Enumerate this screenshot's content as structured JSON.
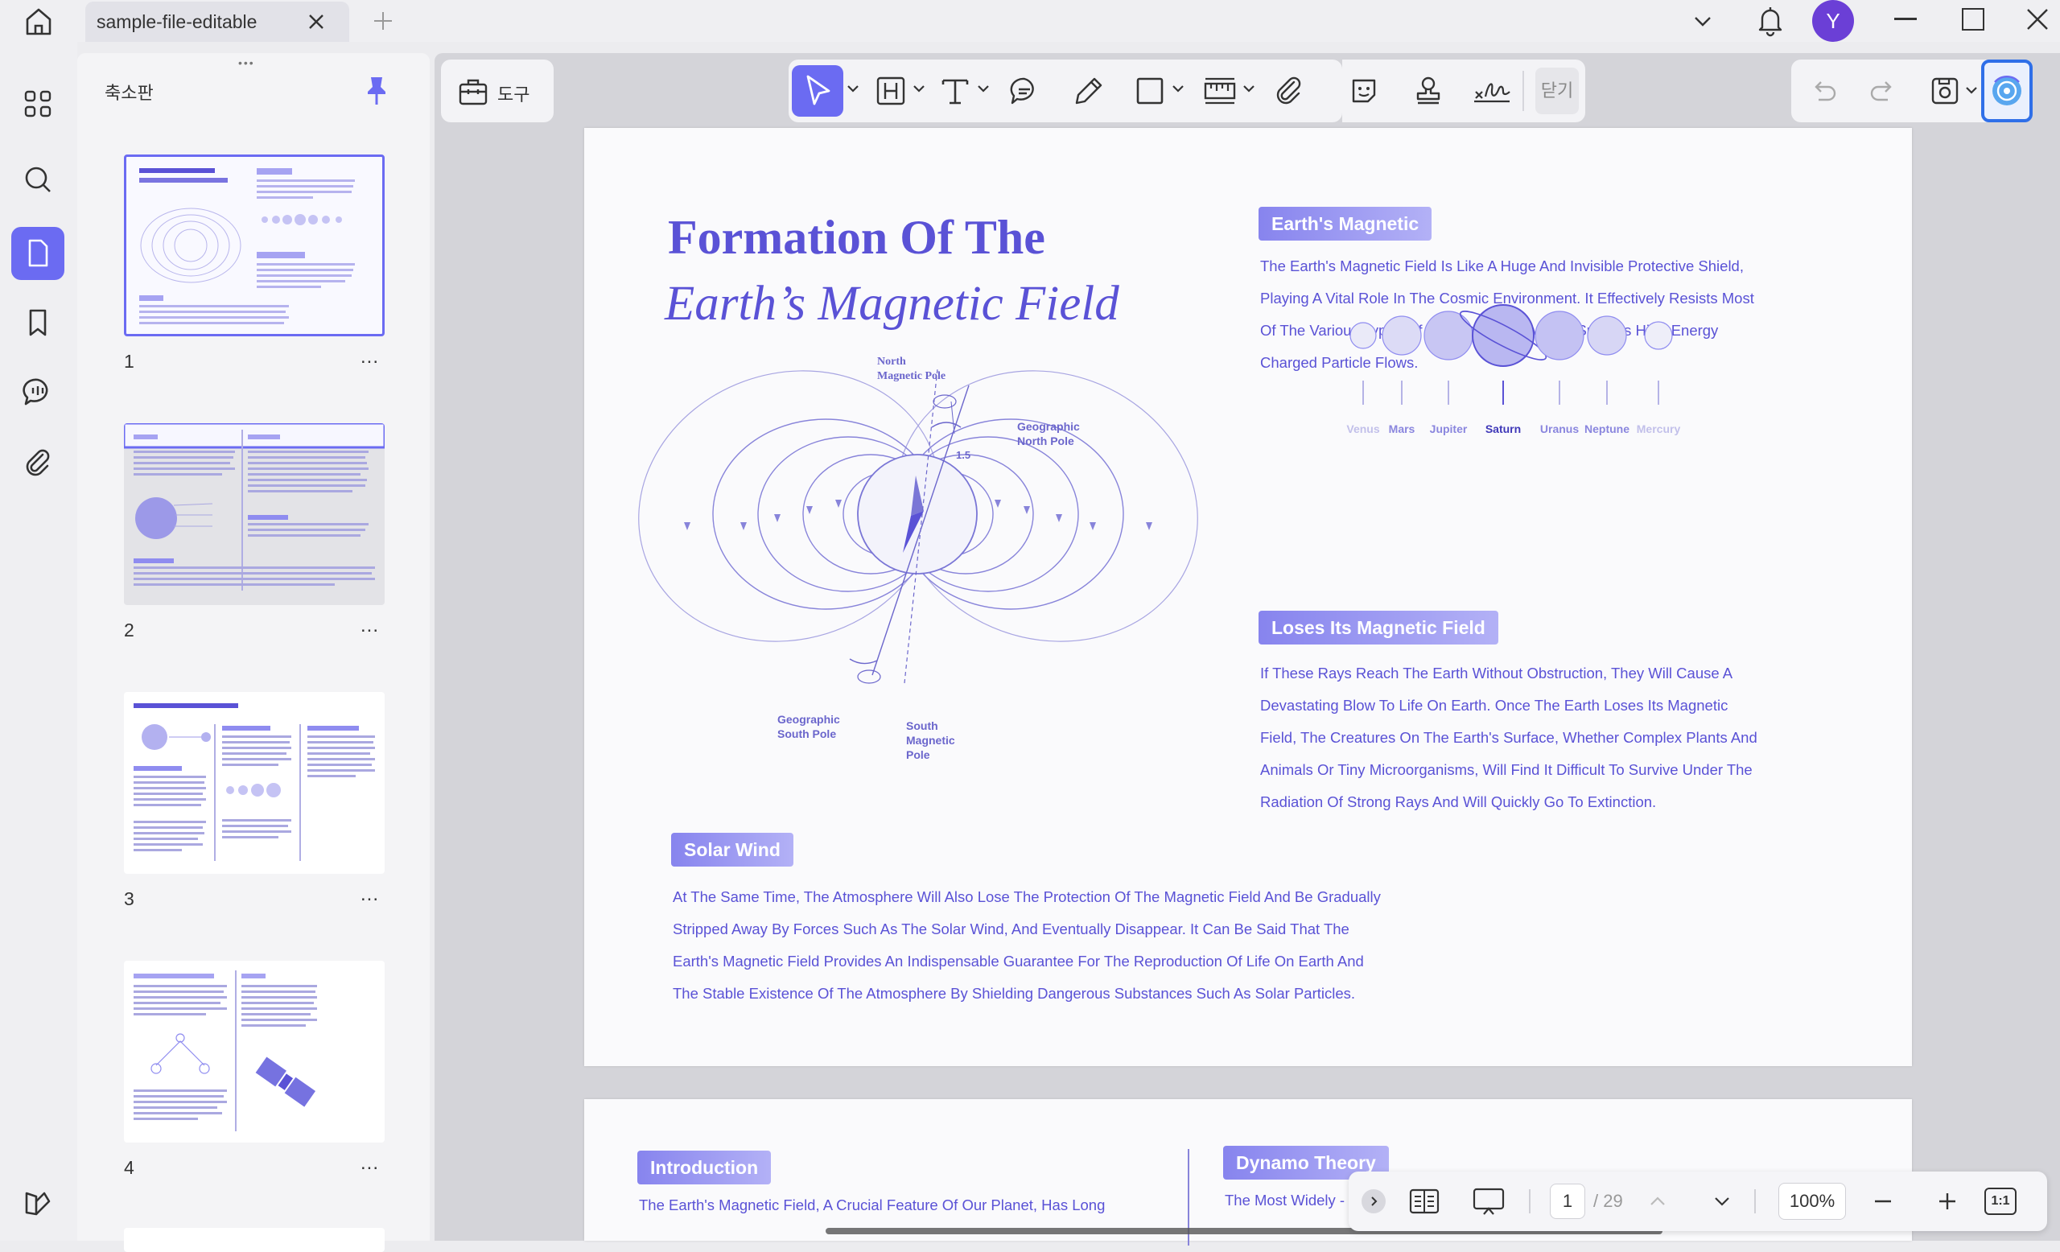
{
  "window": {
    "tab_title": "sample-file-editable"
  },
  "sidebar": {
    "title": "축소판",
    "thumbnails": [
      {
        "number": "1",
        "more": "..."
      },
      {
        "number": "2",
        "more": "..."
      },
      {
        "number": "3",
        "more": "..."
      },
      {
        "number": "4",
        "more": "..."
      }
    ]
  },
  "toolbar": {
    "tools_label": "도구",
    "close_label": "닫기",
    "avatar_letter": "Y"
  },
  "colors": {
    "accent": "#6b6bf2",
    "doc_text": "#5a52d6",
    "badge": "#8f8cf0"
  },
  "document": {
    "title_line1": "Formation Of The",
    "title_line2": "Earth’s Magnetic Field",
    "diagram": {
      "north_magnetic_pole": [
        "North",
        "Magnetic Pole"
      ],
      "geographic_north_pole": [
        "Geographic",
        "North Pole"
      ],
      "angle": "1.5",
      "geographic_south_pole": [
        "Geographic",
        "South Pole"
      ],
      "south_magnetic_pole": [
        "South",
        "Magnetic",
        "Pole"
      ]
    },
    "section_magnetic": {
      "heading": "Earth's Magnetic",
      "lines": [
        "The Earth's Magnetic Field Is Like A Huge And Invisible Protective Shield,",
        "Playing A Vital Role In The Cosmic Environment. It Effectively Resists Most",
        "Of The Various Types Of Rays in The Universe, Such As High-Energy",
        "Charged Particle Flows."
      ]
    },
    "planets": [
      {
        "name": "Venus",
        "highlight": false
      },
      {
        "name": "Mars",
        "highlight": false
      },
      {
        "name": "Jupiter",
        "highlight": false
      },
      {
        "name": "Saturn",
        "highlight": true
      },
      {
        "name": "Uranus",
        "highlight": false
      },
      {
        "name": "Neptune",
        "highlight": false
      },
      {
        "name": "Mercury",
        "highlight": false
      }
    ],
    "section_loses": {
      "heading": "Loses Its Magnetic Field",
      "lines": [
        "If These Rays Reach The Earth Without Obstruction, They Will Cause A",
        "Devastating Blow To Life On Earth. Once The Earth Loses Its Magnetic",
        "Field, The Creatures On The Earth's Surface, Whether Complex Plants And",
        "Animals Or Tiny Microorganisms, Will Find It Difficult To Survive Under The",
        "Radiation Of Strong Rays And Will Quickly Go To Extinction."
      ]
    },
    "section_solar": {
      "heading": "Solar Wind",
      "lines": [
        "At The Same Time, The Atmosphere Will Also Lose The Protection Of The Magnetic Field And Be Gradually",
        "Stripped Away By Forces Such As The Solar Wind, And Eventually Disappear. It Can Be Said That The",
        "Earth's Magnetic Field Provides An Indispensable Guarantee For The Reproduction Of Life On Earth And",
        "The Stable Existence Of The Atmosphere By Shielding Dangerous Substances Such As Solar Particles."
      ]
    },
    "page2": {
      "intro_heading": "Introduction",
      "intro_line": "The Earth's Magnetic Field, A Crucial Feature Of Our Planet, Has Long",
      "dynamo_heading": "Dynamo Theory",
      "dynamo_line": "The Most Widely -"
    }
  },
  "bottom_bar": {
    "current_page": "1",
    "total_pages": "/ 29",
    "zoom": "100%",
    "fit_label": "1:1"
  }
}
